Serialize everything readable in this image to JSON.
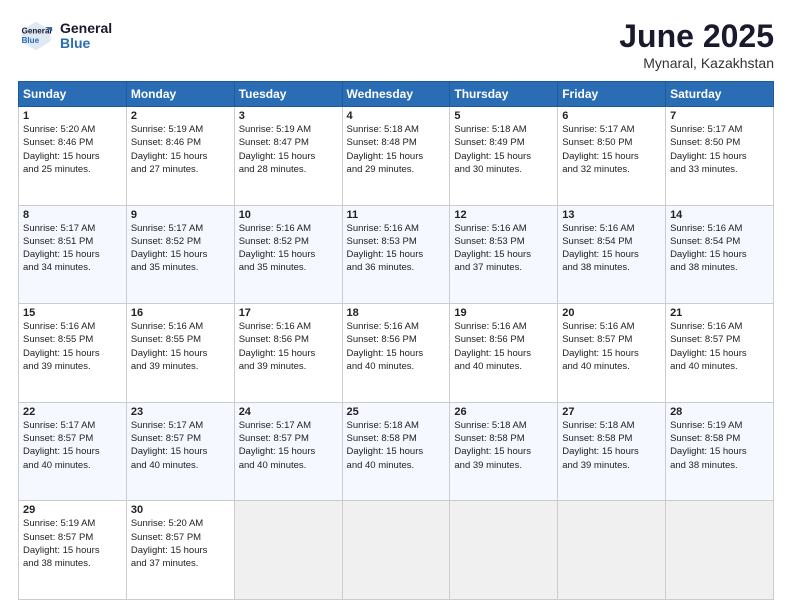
{
  "logo": {
    "line1": "General",
    "line2": "Blue"
  },
  "title": "June 2025",
  "location": "Mynaral, Kazakhstan",
  "headers": [
    "Sunday",
    "Monday",
    "Tuesday",
    "Wednesday",
    "Thursday",
    "Friday",
    "Saturday"
  ],
  "weeks": [
    [
      {
        "day": "1",
        "sunrise": "5:20 AM",
        "sunset": "8:46 PM",
        "daylight": "15 hours and 25 minutes."
      },
      {
        "day": "2",
        "sunrise": "5:19 AM",
        "sunset": "8:46 PM",
        "daylight": "15 hours and 27 minutes."
      },
      {
        "day": "3",
        "sunrise": "5:19 AM",
        "sunset": "8:47 PM",
        "daylight": "15 hours and 28 minutes."
      },
      {
        "day": "4",
        "sunrise": "5:18 AM",
        "sunset": "8:48 PM",
        "daylight": "15 hours and 29 minutes."
      },
      {
        "day": "5",
        "sunrise": "5:18 AM",
        "sunset": "8:49 PM",
        "daylight": "15 hours and 30 minutes."
      },
      {
        "day": "6",
        "sunrise": "5:17 AM",
        "sunset": "8:50 PM",
        "daylight": "15 hours and 32 minutes."
      },
      {
        "day": "7",
        "sunrise": "5:17 AM",
        "sunset": "8:50 PM",
        "daylight": "15 hours and 33 minutes."
      }
    ],
    [
      {
        "day": "8",
        "sunrise": "5:17 AM",
        "sunset": "8:51 PM",
        "daylight": "15 hours and 34 minutes."
      },
      {
        "day": "9",
        "sunrise": "5:17 AM",
        "sunset": "8:52 PM",
        "daylight": "15 hours and 35 minutes."
      },
      {
        "day": "10",
        "sunrise": "5:16 AM",
        "sunset": "8:52 PM",
        "daylight": "15 hours and 35 minutes."
      },
      {
        "day": "11",
        "sunrise": "5:16 AM",
        "sunset": "8:53 PM",
        "daylight": "15 hours and 36 minutes."
      },
      {
        "day": "12",
        "sunrise": "5:16 AM",
        "sunset": "8:53 PM",
        "daylight": "15 hours and 37 minutes."
      },
      {
        "day": "13",
        "sunrise": "5:16 AM",
        "sunset": "8:54 PM",
        "daylight": "15 hours and 38 minutes."
      },
      {
        "day": "14",
        "sunrise": "5:16 AM",
        "sunset": "8:54 PM",
        "daylight": "15 hours and 38 minutes."
      }
    ],
    [
      {
        "day": "15",
        "sunrise": "5:16 AM",
        "sunset": "8:55 PM",
        "daylight": "15 hours and 39 minutes."
      },
      {
        "day": "16",
        "sunrise": "5:16 AM",
        "sunset": "8:55 PM",
        "daylight": "15 hours and 39 minutes."
      },
      {
        "day": "17",
        "sunrise": "5:16 AM",
        "sunset": "8:56 PM",
        "daylight": "15 hours and 39 minutes."
      },
      {
        "day": "18",
        "sunrise": "5:16 AM",
        "sunset": "8:56 PM",
        "daylight": "15 hours and 40 minutes."
      },
      {
        "day": "19",
        "sunrise": "5:16 AM",
        "sunset": "8:56 PM",
        "daylight": "15 hours and 40 minutes."
      },
      {
        "day": "20",
        "sunrise": "5:16 AM",
        "sunset": "8:57 PM",
        "daylight": "15 hours and 40 minutes."
      },
      {
        "day": "21",
        "sunrise": "5:16 AM",
        "sunset": "8:57 PM",
        "daylight": "15 hours and 40 minutes."
      }
    ],
    [
      {
        "day": "22",
        "sunrise": "5:17 AM",
        "sunset": "8:57 PM",
        "daylight": "15 hours and 40 minutes."
      },
      {
        "day": "23",
        "sunrise": "5:17 AM",
        "sunset": "8:57 PM",
        "daylight": "15 hours and 40 minutes."
      },
      {
        "day": "24",
        "sunrise": "5:17 AM",
        "sunset": "8:57 PM",
        "daylight": "15 hours and 40 minutes."
      },
      {
        "day": "25",
        "sunrise": "5:18 AM",
        "sunset": "8:58 PM",
        "daylight": "15 hours and 40 minutes."
      },
      {
        "day": "26",
        "sunrise": "5:18 AM",
        "sunset": "8:58 PM",
        "daylight": "15 hours and 39 minutes."
      },
      {
        "day": "27",
        "sunrise": "5:18 AM",
        "sunset": "8:58 PM",
        "daylight": "15 hours and 39 minutes."
      },
      {
        "day": "28",
        "sunrise": "5:19 AM",
        "sunset": "8:58 PM",
        "daylight": "15 hours and 38 minutes."
      }
    ],
    [
      {
        "day": "29",
        "sunrise": "5:19 AM",
        "sunset": "8:57 PM",
        "daylight": "15 hours and 38 minutes."
      },
      {
        "day": "30",
        "sunrise": "5:20 AM",
        "sunset": "8:57 PM",
        "daylight": "15 hours and 37 minutes."
      },
      null,
      null,
      null,
      null,
      null
    ]
  ]
}
